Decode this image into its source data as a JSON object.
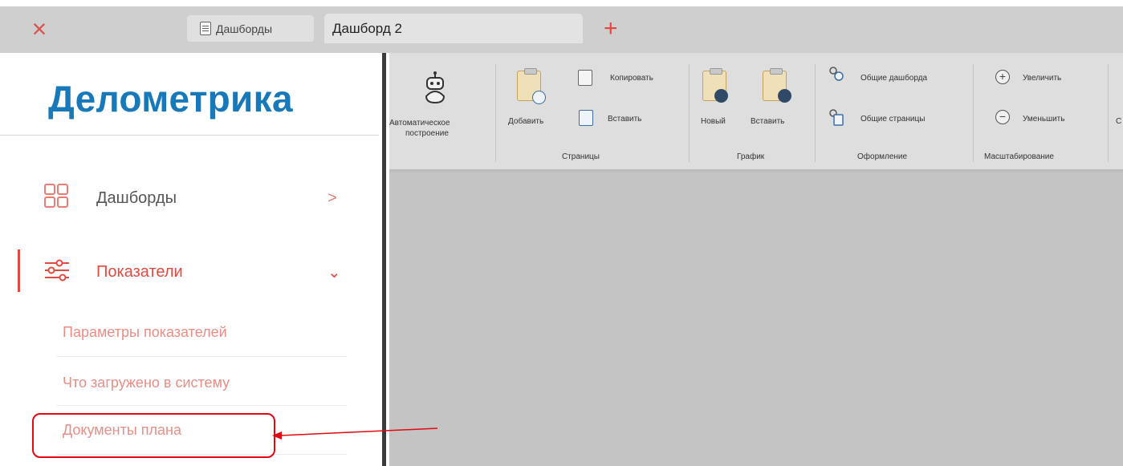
{
  "tabs": {
    "close_icon": "×",
    "dashboards_tab": "Дашборды",
    "active_tab": "Дашборд 2",
    "add_icon": "+"
  },
  "sidebar": {
    "logo": "Делометрика",
    "items": [
      {
        "label": "Дашборды",
        "chevron": ">"
      },
      {
        "label": "Показатели",
        "chevron": "⌄"
      }
    ],
    "subitems": [
      {
        "label": "Параметры показателей"
      },
      {
        "label": "Что загружено в систему"
      },
      {
        "label": "Документы плана"
      }
    ]
  },
  "ribbon": {
    "auto_build": {
      "line1": "Автоматическое",
      "line2": "построение"
    },
    "pages": {
      "add": "Добавить",
      "copy": "Копировать",
      "paste": "Вставить",
      "group": "Страницы"
    },
    "chart": {
      "new": "Новый",
      "paste": "Вставить",
      "group": "График"
    },
    "design": {
      "shared_dashboards": "Общие дашборда",
      "shared_pages": "Общие страницы",
      "group": "Оформление"
    },
    "zoom": {
      "increase": "Увеличить",
      "decrease": "Уменьшить",
      "group": "Масштабирование"
    },
    "overflow": "С"
  },
  "colors": {
    "logo": "#1779ba",
    "accent": "#e24a40",
    "highlight": "#e30613"
  }
}
